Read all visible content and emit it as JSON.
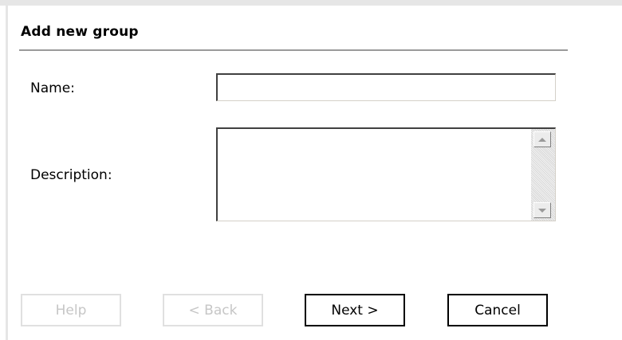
{
  "dialog": {
    "title": "Add new group"
  },
  "form": {
    "name_label": "Name:",
    "name_value": "",
    "description_label": "Description:",
    "description_value": ""
  },
  "buttons": {
    "help": "Help",
    "back": "< Back",
    "next": "Next >",
    "cancel": "Cancel"
  },
  "icons": {
    "scroll_up": "scroll-up-arrow-icon",
    "scroll_down": "scroll-down-arrow-icon"
  },
  "colors": {
    "divider": "#9a9a9a",
    "disabled_text": "#c6c6c6",
    "frame": "#e6e6e6"
  }
}
